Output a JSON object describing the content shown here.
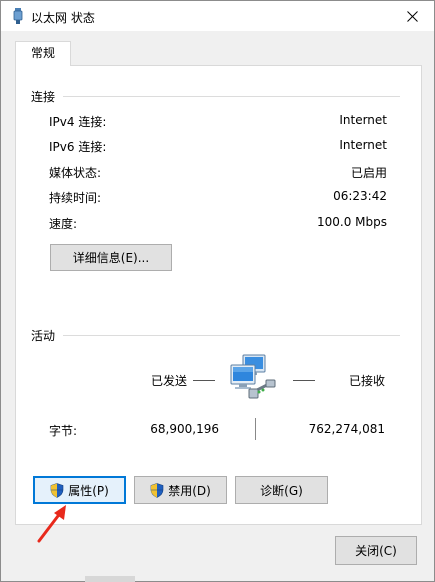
{
  "window": {
    "title": "以太网 状态",
    "close_icon": "close-icon"
  },
  "tabs": [
    {
      "label": "常规"
    }
  ],
  "connection": {
    "title": "连接",
    "rows": [
      {
        "label": "IPv4 连接:",
        "value": "Internet"
      },
      {
        "label": "IPv6 连接:",
        "value": "Internet"
      },
      {
        "label": "媒体状态:",
        "value": "已启用"
      },
      {
        "label": "持续时间:",
        "value": "06:23:42"
      },
      {
        "label": "速度:",
        "value": "100.0 Mbps"
      }
    ],
    "details_button": "详细信息(E)..."
  },
  "activity": {
    "title": "活动",
    "sent_label": "已发送",
    "received_label": "已接收",
    "bytes_label": "字节:",
    "bytes_sent": "68,900,196",
    "bytes_received": "762,274,081",
    "icon": "network-computers-icon"
  },
  "buttons": {
    "properties": "属性(P)",
    "disable": "禁用(D)",
    "diagnose": "诊断(G)",
    "close": "关闭(C)"
  },
  "colors": {
    "focus_border": "#0078d7",
    "arrow": "#e8291c"
  }
}
